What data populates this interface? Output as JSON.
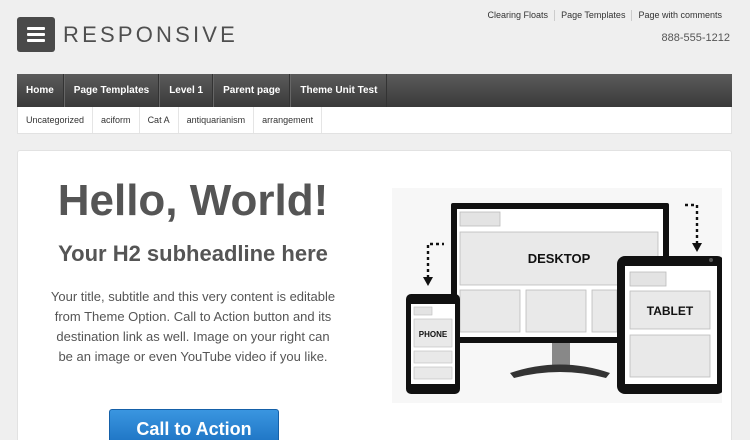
{
  "brand": {
    "logo_text": "RESPONSIVE"
  },
  "top_menu": [
    "Clearing Floats",
    "Page Templates",
    "Page with comments"
  ],
  "phone": "888-555-1212",
  "main_nav": [
    "Home",
    "Page Templates",
    "Level 1",
    "Parent page",
    "Theme Unit Test"
  ],
  "sub_nav": [
    "Uncategorized",
    "aciform",
    "Cat A",
    "antiquarianism",
    "arrangement"
  ],
  "hero": {
    "headline": "Hello, World!",
    "subheadline": "Your H2 subheadline here",
    "description": "Your title, subtitle and this very content is editable from Theme Option. Call to Action button and its destination link as well. Image on your right can be an image or even YouTube video if you like.",
    "cta_label": "Call to Action"
  },
  "devices": {
    "desktop": "DESKTOP",
    "tablet": "TABLET",
    "phone": "PHONE"
  },
  "colors": {
    "nav_bg": "#444444",
    "cta_blue": "#2a85d4",
    "page_bg": "#efefef"
  }
}
